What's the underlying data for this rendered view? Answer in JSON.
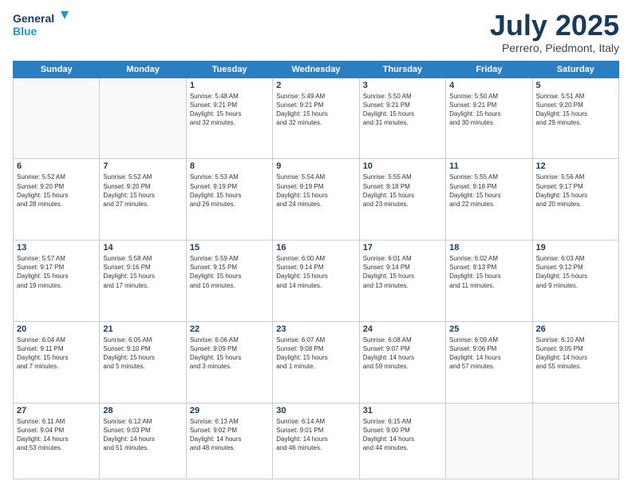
{
  "header": {
    "logo_line1": "General",
    "logo_line2": "Blue",
    "month_title": "July 2025",
    "location": "Perrero, Piedmont, Italy"
  },
  "days_of_week": [
    "Sunday",
    "Monday",
    "Tuesday",
    "Wednesday",
    "Thursday",
    "Friday",
    "Saturday"
  ],
  "weeks": [
    [
      {
        "day": "",
        "info": ""
      },
      {
        "day": "",
        "info": ""
      },
      {
        "day": "1",
        "info": "Sunrise: 5:48 AM\nSunset: 9:21 PM\nDaylight: 15 hours\nand 32 minutes."
      },
      {
        "day": "2",
        "info": "Sunrise: 5:49 AM\nSunset: 9:21 PM\nDaylight: 15 hours\nand 32 minutes."
      },
      {
        "day": "3",
        "info": "Sunrise: 5:50 AM\nSunset: 9:21 PM\nDaylight: 15 hours\nand 31 minutes."
      },
      {
        "day": "4",
        "info": "Sunrise: 5:50 AM\nSunset: 9:21 PM\nDaylight: 15 hours\nand 30 minutes."
      },
      {
        "day": "5",
        "info": "Sunrise: 5:51 AM\nSunset: 9:20 PM\nDaylight: 15 hours\nand 29 minutes."
      }
    ],
    [
      {
        "day": "6",
        "info": "Sunrise: 5:52 AM\nSunset: 9:20 PM\nDaylight: 15 hours\nand 28 minutes."
      },
      {
        "day": "7",
        "info": "Sunrise: 5:52 AM\nSunset: 9:20 PM\nDaylight: 15 hours\nand 27 minutes."
      },
      {
        "day": "8",
        "info": "Sunrise: 5:53 AM\nSunset: 9:19 PM\nDaylight: 15 hours\nand 26 minutes."
      },
      {
        "day": "9",
        "info": "Sunrise: 5:54 AM\nSunset: 9:19 PM\nDaylight: 15 hours\nand 24 minutes."
      },
      {
        "day": "10",
        "info": "Sunrise: 5:55 AM\nSunset: 9:18 PM\nDaylight: 15 hours\nand 23 minutes."
      },
      {
        "day": "11",
        "info": "Sunrise: 5:55 AM\nSunset: 9:18 PM\nDaylight: 15 hours\nand 22 minutes."
      },
      {
        "day": "12",
        "info": "Sunrise: 5:56 AM\nSunset: 9:17 PM\nDaylight: 15 hours\nand 20 minutes."
      }
    ],
    [
      {
        "day": "13",
        "info": "Sunrise: 5:57 AM\nSunset: 9:17 PM\nDaylight: 15 hours\nand 19 minutes."
      },
      {
        "day": "14",
        "info": "Sunrise: 5:58 AM\nSunset: 9:16 PM\nDaylight: 15 hours\nand 17 minutes."
      },
      {
        "day": "15",
        "info": "Sunrise: 5:59 AM\nSunset: 9:15 PM\nDaylight: 15 hours\nand 16 minutes."
      },
      {
        "day": "16",
        "info": "Sunrise: 6:00 AM\nSunset: 9:14 PM\nDaylight: 15 hours\nand 14 minutes."
      },
      {
        "day": "17",
        "info": "Sunrise: 6:01 AM\nSunset: 9:14 PM\nDaylight: 15 hours\nand 13 minutes."
      },
      {
        "day": "18",
        "info": "Sunrise: 6:02 AM\nSunset: 9:13 PM\nDaylight: 15 hours\nand 11 minutes."
      },
      {
        "day": "19",
        "info": "Sunrise: 6:03 AM\nSunset: 9:12 PM\nDaylight: 15 hours\nand 9 minutes."
      }
    ],
    [
      {
        "day": "20",
        "info": "Sunrise: 6:04 AM\nSunset: 9:11 PM\nDaylight: 15 hours\nand 7 minutes."
      },
      {
        "day": "21",
        "info": "Sunrise: 6:05 AM\nSunset: 9:10 PM\nDaylight: 15 hours\nand 5 minutes."
      },
      {
        "day": "22",
        "info": "Sunrise: 6:06 AM\nSunset: 9:09 PM\nDaylight: 15 hours\nand 3 minutes."
      },
      {
        "day": "23",
        "info": "Sunrise: 6:07 AM\nSunset: 9:08 PM\nDaylight: 15 hours\nand 1 minute."
      },
      {
        "day": "24",
        "info": "Sunrise: 6:08 AM\nSunset: 9:07 PM\nDaylight: 14 hours\nand 59 minutes."
      },
      {
        "day": "25",
        "info": "Sunrise: 6:09 AM\nSunset: 9:06 PM\nDaylight: 14 hours\nand 57 minutes."
      },
      {
        "day": "26",
        "info": "Sunrise: 6:10 AM\nSunset: 9:05 PM\nDaylight: 14 hours\nand 55 minutes."
      }
    ],
    [
      {
        "day": "27",
        "info": "Sunrise: 6:11 AM\nSunset: 9:04 PM\nDaylight: 14 hours\nand 53 minutes."
      },
      {
        "day": "28",
        "info": "Sunrise: 6:12 AM\nSunset: 9:03 PM\nDaylight: 14 hours\nand 51 minutes."
      },
      {
        "day": "29",
        "info": "Sunrise: 6:13 AM\nSunset: 9:02 PM\nDaylight: 14 hours\nand 48 minutes."
      },
      {
        "day": "30",
        "info": "Sunrise: 6:14 AM\nSunset: 9:01 PM\nDaylight: 14 hours\nand 46 minutes."
      },
      {
        "day": "31",
        "info": "Sunrise: 6:15 AM\nSunset: 9:00 PM\nDaylight: 14 hours\nand 44 minutes."
      },
      {
        "day": "",
        "info": ""
      },
      {
        "day": "",
        "info": ""
      }
    ]
  ]
}
